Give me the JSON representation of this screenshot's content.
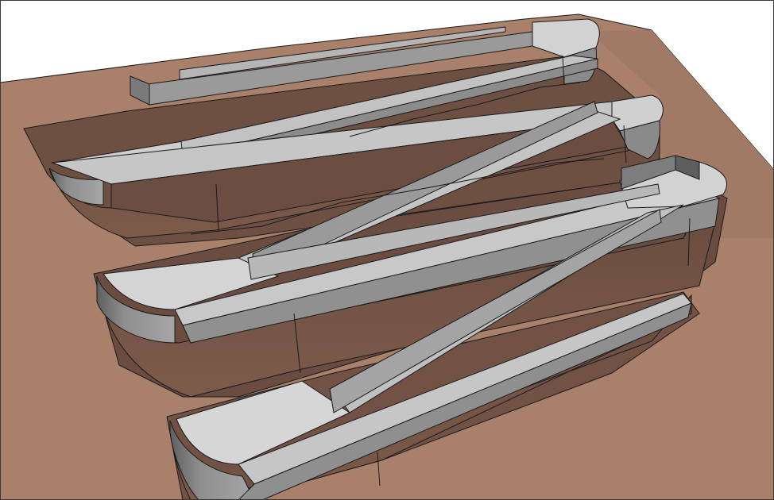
{
  "view": {
    "kind": "3d-model-viewport",
    "subject": "switchback-ramps-on-terrain"
  },
  "colors": {
    "background": "#ffffff",
    "terrain_light": "#a9806a",
    "terrain_mid": "#8a6452",
    "terrain_shadow": "#6b4e41",
    "cut_face": "#5a4238",
    "ramp_top": "#c8c8c8",
    "ramp_light": "#d9d9d9",
    "wall_face": "#8f8f8f",
    "wall_dark": "#6e6e6e",
    "edge": "#1a1a1a"
  },
  "legend": []
}
